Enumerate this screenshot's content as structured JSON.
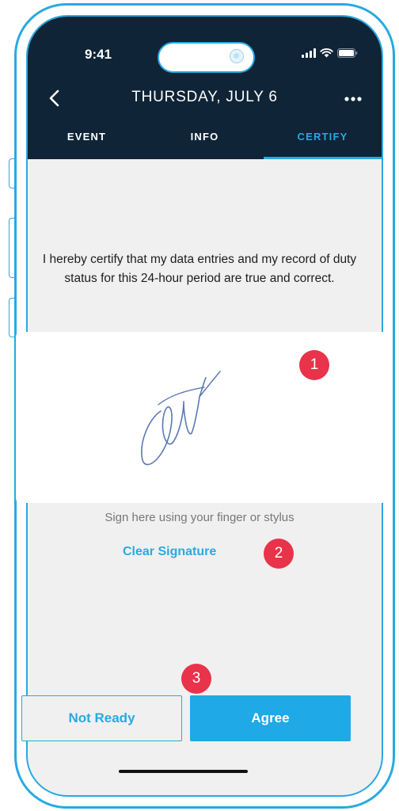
{
  "status_bar": {
    "time": "9:41",
    "icons": [
      "signal-icon",
      "wifi-icon",
      "battery-icon"
    ]
  },
  "header": {
    "title": "THURSDAY, JULY 6",
    "back_icon": "chevron-left-icon",
    "more_icon": "more-dots-icon"
  },
  "tabs": [
    {
      "label": "EVENT",
      "active": false
    },
    {
      "label": "INFO",
      "active": false
    },
    {
      "label": "CERTIFY",
      "active": true
    }
  ],
  "certify": {
    "statement": "I hereby certify that my data entries and my record of duty status for this 24-hour period are true and correct.",
    "hint": "Sign here using your finger or stylus",
    "clear_label": "Clear Signature"
  },
  "badges": [
    "1",
    "2",
    "3"
  ],
  "actions": {
    "not_ready_label": "Not Ready",
    "agree_label": "Agree"
  },
  "colors": {
    "accent": "#29a9e1",
    "header_bg": "#0f2437",
    "badge": "#e8334a",
    "screen_bg": "#f0f0f0"
  }
}
